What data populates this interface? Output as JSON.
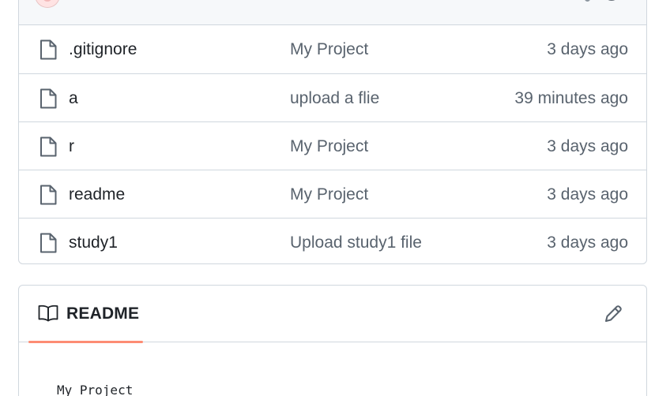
{
  "files": [
    {
      "name": ".gitignore",
      "commit_message": "My Project",
      "age": "3 days ago"
    },
    {
      "name": "a",
      "commit_message": "upload a flie",
      "age": "39 minutes ago"
    },
    {
      "name": "r",
      "commit_message": "My Project",
      "age": "3 days ago"
    },
    {
      "name": "readme",
      "commit_message": "My Project",
      "age": "3 days ago"
    },
    {
      "name": "study1",
      "commit_message": "Upload study1 file",
      "age": "3 days ago"
    }
  ],
  "readme": {
    "tab_label": "README",
    "content": "My Project",
    "edit_icon": "pencil-icon",
    "tab_icon": "book-icon"
  },
  "colors": {
    "border": "#d0d7de",
    "muted_text": "#59636e",
    "tab_underline": "#fd8c73",
    "header_bg": "#f6f8fa"
  },
  "icons": {
    "file": "file-icon",
    "history": "history-icon",
    "avatar": "avatar"
  }
}
